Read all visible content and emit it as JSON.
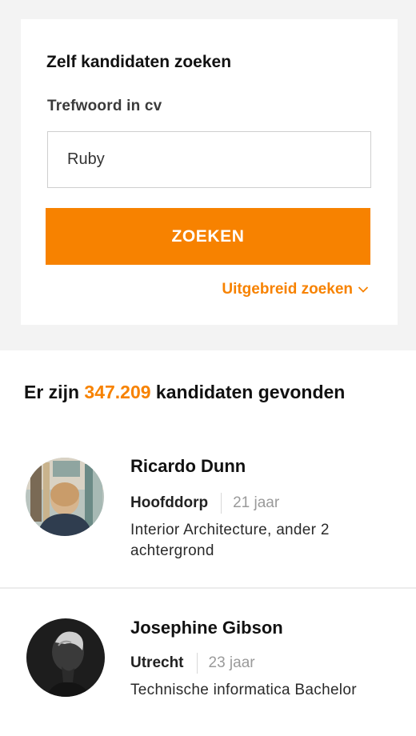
{
  "search": {
    "title": "Zelf kandidaten zoeken",
    "field_label": "Trefwoord in cv",
    "keyword_value": "Ruby",
    "button_label": "ZOEKEN",
    "advanced_label": "Uitgebreid zoeken",
    "advanced_icon": "chevron-down-icon"
  },
  "results": {
    "prefix": "Er zijn ",
    "count": "347.209",
    "suffix": " kandidaten gevonden"
  },
  "candidates": [
    {
      "name": "Ricardo Dunn",
      "city": "Hoofddorp",
      "age": "21 jaar",
      "description": "Interior Architecture, ander 2 achtergrond",
      "avatar": "candidate-photo"
    },
    {
      "name": "Josephine Gibson",
      "city": "Utrecht",
      "age": "23 jaar",
      "description": "Technische informatica Bachelor",
      "avatar": "candidate-photo"
    }
  ],
  "colors": {
    "accent": "#f78200",
    "top_background": "#f3f3f3"
  }
}
